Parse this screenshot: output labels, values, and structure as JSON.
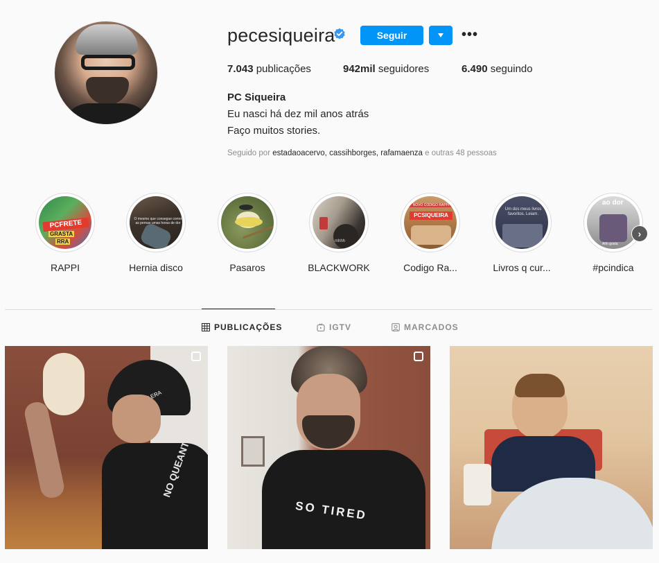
{
  "profile": {
    "username": "pecesiqueira",
    "follow_label": "Seguir",
    "more_label": "•••",
    "stats": [
      {
        "value": "7.043",
        "label": " publicações"
      },
      {
        "value": "942mil",
        "label": " seguidores"
      },
      {
        "value": "6.490",
        "label": " seguindo"
      }
    ],
    "full_name": "PC Siqueira",
    "bio_lines": [
      "Eu nasci há dez mil anos atrás",
      "Faço muitos stories."
    ],
    "followed_by": {
      "prefix": "Seguido por ",
      "users": [
        "estadaoacervo",
        "cassihborges",
        "rafamaenza"
      ],
      "sep1": ", ",
      "sep2": ", ",
      "suffix": " e outras 48 pessoas"
    }
  },
  "highlights": [
    {
      "label": "RAPPI"
    },
    {
      "label": "Hernia disco"
    },
    {
      "label": "Pasaros"
    },
    {
      "label": "BLACKWORK"
    },
    {
      "label": "Codigo Ra..."
    },
    {
      "label": "Livros q cur..."
    },
    {
      "label": "#pcindica"
    }
  ],
  "highlight_overlay_text": {
    "rappi_line1": "PCFRETE",
    "rappi_line2": "GRASTA",
    "rappi_line3": "RRA",
    "codigo": "PCSIQUEIRA",
    "codigo_top": "NOVO CODIGO RAPPI",
    "livros": "Um dos meus livros favoritos. Leiam.",
    "hernia": "O mesmo que consegue correr as pernas umas horas de dor",
    "pcindica": "ao dor",
    "pcindica_small": "Ahh gosta",
    "blackwork": "mhhh"
  },
  "tabs": [
    {
      "label": "PUBLICAÇÕES",
      "icon": "grid-icon",
      "active": true
    },
    {
      "label": "IGTV",
      "icon": "igtv-icon",
      "active": false
    },
    {
      "label": "MARCADOS",
      "icon": "tagged-icon",
      "active": false
    }
  ],
  "posts": [
    {
      "icon": "multiple-images-icon"
    },
    {
      "icon": "multiple-images-icon"
    },
    {
      "icon": ""
    }
  ],
  "post_text": {
    "shirt1": "NO QUEANT",
    "shirt2": "SO TIRED",
    "cap": "NEW ERA"
  },
  "colors": {
    "accent": "#0095f6",
    "verified": "#3897f0",
    "text": "#262626",
    "muted": "#8e8e8e"
  }
}
